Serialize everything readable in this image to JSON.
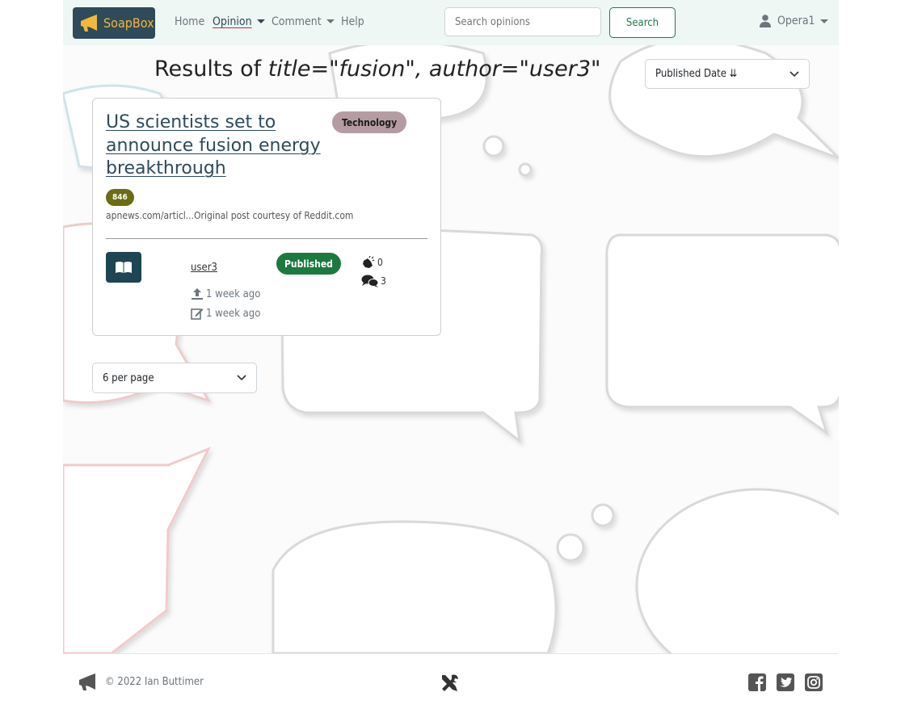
{
  "navbar": {
    "brand": "SoapBox",
    "links": [
      {
        "label": "Home"
      },
      {
        "label": "Opinion"
      },
      {
        "label": "Comment"
      },
      {
        "label": "Help"
      }
    ],
    "search_placeholder": "Search opinions",
    "search_button": "Search",
    "user": "Opera1"
  },
  "results": {
    "prefix": "Results of ",
    "query": "title=\"fusion\", author=\"user3\""
  },
  "sort": {
    "selected": "Published Date ⇊"
  },
  "opinions": [
    {
      "title": "US scientists set to announce fusion energy breakthrough",
      "category": "Technology",
      "id": "846",
      "source": "apnews.com/articl...Original post courtesy of Reddit.com",
      "author": "user3",
      "status": "Published",
      "published": "1 week ago",
      "updated": "1 week ago",
      "reactions": "0",
      "comments": "3"
    }
  ],
  "pagination": {
    "per_page": "6 per page"
  },
  "footer": {
    "copyright": "© 2022 Ian Buttimer"
  },
  "colors": {
    "navbar_bg": "#eef7f3",
    "brand_bg": "#2f4a5a",
    "brand_text": "#f2b83b",
    "category_badge": "#b59ca3",
    "id_badge": "#6b6d12",
    "status_published": "#1c7a3e",
    "read_button": "#1d4554",
    "search_button": "#1f7a4a"
  }
}
